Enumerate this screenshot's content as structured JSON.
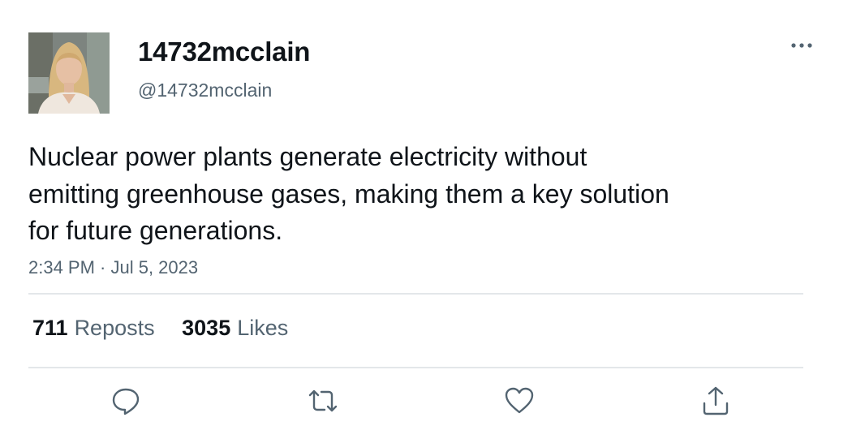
{
  "author": {
    "display_name": "14732mcclain",
    "handle": "@14732mcclain"
  },
  "tweet": {
    "text": "Nuclear power plants generate electricity without\nemitting greenhouse gases, making them a key solution\nfor future generations.",
    "timestamp": "2:34 PM · Jul 5, 2023"
  },
  "stats": {
    "reposts_count": "711",
    "reposts_label": "Reposts",
    "likes_count": "3035",
    "likes_label": "Likes"
  },
  "icons": {
    "more": "more-horizontal-icon",
    "reply": "reply-icon",
    "repost": "repost-icon",
    "like": "heart-icon",
    "share": "share-icon"
  },
  "colors": {
    "text_primary": "#0f1419",
    "text_secondary": "#536471",
    "divider": "#e3e7ea"
  }
}
